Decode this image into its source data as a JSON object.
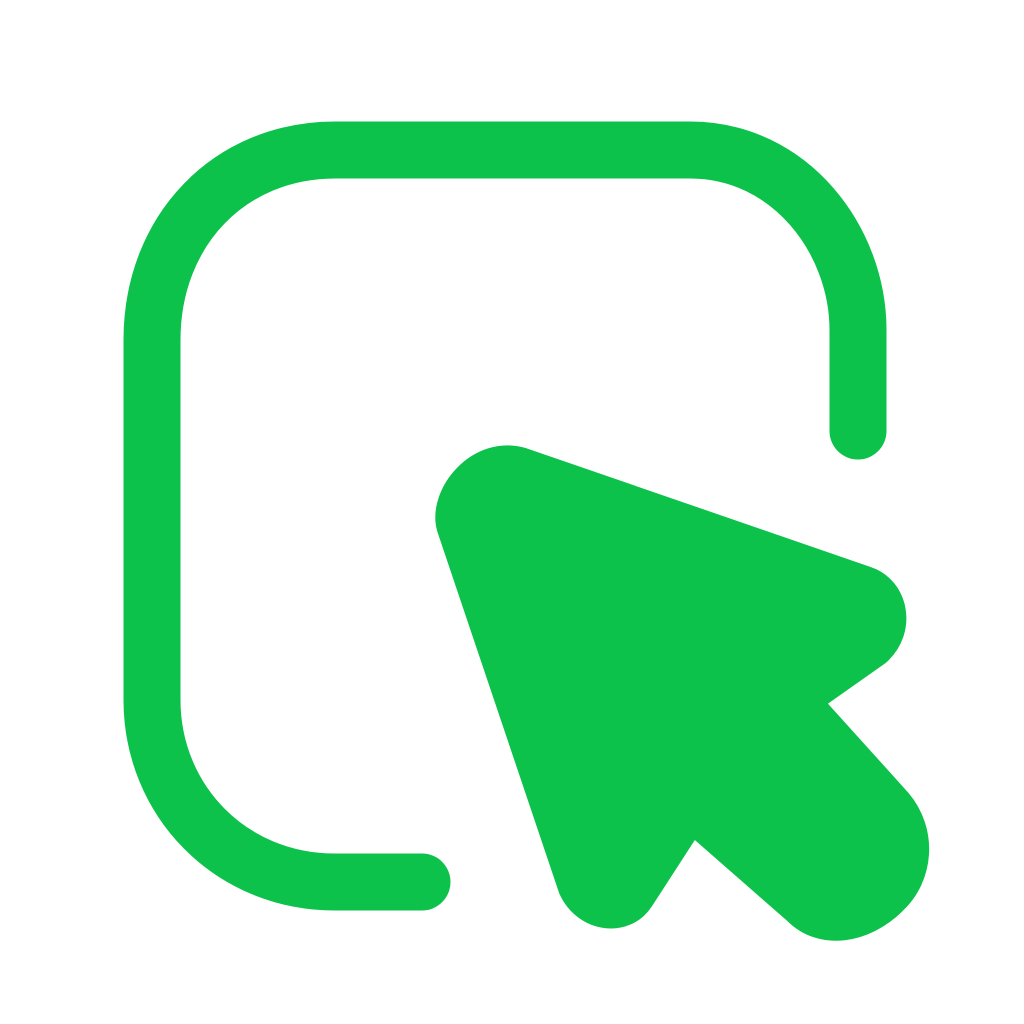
{
  "icon": {
    "name": "select-cursor-icon",
    "frame_icon": "rounded-square-outline",
    "pointer_icon": "mouse-pointer-arrow"
  },
  "colors": {
    "background": "#ffffff",
    "accent": "#0cc24a"
  }
}
